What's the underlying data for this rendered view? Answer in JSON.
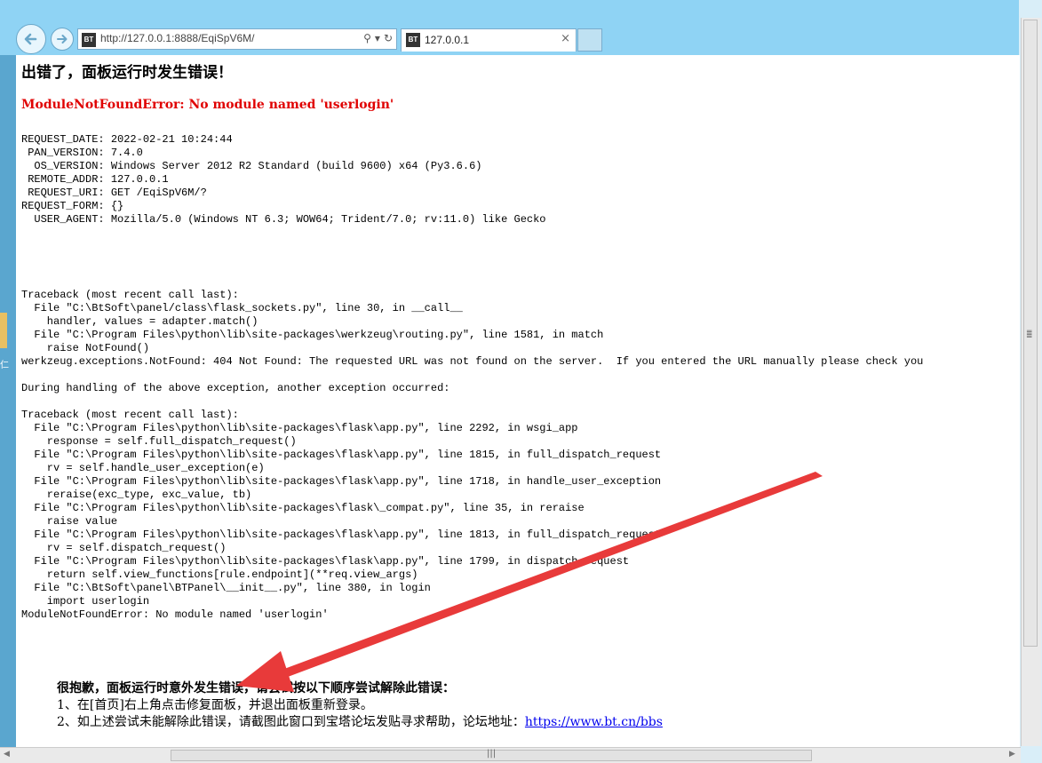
{
  "browser": {
    "url": "http://127.0.0.1:8888/EqiSpV6M/",
    "favicon_text": "BT",
    "tab_title": "127.0.0.1",
    "close_glyph": "×",
    "addr_icons": [
      "⚲",
      "▾",
      "↻"
    ]
  },
  "page": {
    "heading": "出错了，面板运行时发生错误！",
    "error_title": "ModuleNotFoundError: No module named 'userlogin'",
    "request_info": [
      "REQUEST_DATE: 2022-02-21 10:24:44",
      " PAN_VERSION: 7.4.0",
      "  OS_VERSION: Windows Server 2012 R2 Standard (build 9600) x64 (Py3.6.6)",
      " REMOTE_ADDR: 127.0.0.1",
      " REQUEST_URI: GET /EqiSpV6M/?",
      "REQUEST_FORM: {}",
      "  USER_AGENT: Mozilla/5.0 (Windows NT 6.3; WOW64; Trident/7.0; rv:11.0) like Gecko"
    ],
    "traceback": [
      "Traceback (most recent call last):",
      "  File \"C:\\BtSoft\\panel/class\\flask_sockets.py\", line 30, in __call__",
      "    handler, values = adapter.match()",
      "  File \"C:\\Program Files\\python\\lib\\site-packages\\werkzeug\\routing.py\", line 1581, in match",
      "    raise NotFound()",
      "werkzeug.exceptions.NotFound: 404 Not Found: The requested URL was not found on the server.  If you entered the URL manually please check you",
      "",
      "During handling of the above exception, another exception occurred:",
      "",
      "Traceback (most recent call last):",
      "  File \"C:\\Program Files\\python\\lib\\site-packages\\flask\\app.py\", line 2292, in wsgi_app",
      "    response = self.full_dispatch_request()",
      "  File \"C:\\Program Files\\python\\lib\\site-packages\\flask\\app.py\", line 1815, in full_dispatch_request",
      "    rv = self.handle_user_exception(e)",
      "  File \"C:\\Program Files\\python\\lib\\site-packages\\flask\\app.py\", line 1718, in handle_user_exception",
      "    reraise(exc_type, exc_value, tb)",
      "  File \"C:\\Program Files\\python\\lib\\site-packages\\flask\\_compat.py\", line 35, in reraise",
      "    raise value",
      "  File \"C:\\Program Files\\python\\lib\\site-packages\\flask\\app.py\", line 1813, in full_dispatch_request",
      "    rv = self.dispatch_request()",
      "  File \"C:\\Program Files\\python\\lib\\site-packages\\flask\\app.py\", line 1799, in dispatch_request",
      "    return self.view_functions[rule.endpoint](**req.view_args)",
      "  File \"C:\\BtSoft\\panel\\BTPanel\\__init__.py\", line 380, in login",
      "    import userlogin",
      "ModuleNotFoundError: No module named 'userlogin'"
    ],
    "help": {
      "title": "很抱歉，面板运行时意外发生错误，请尝试按以下顺序尝试解除此错误：",
      "step1": "1、在[首页]右上角点击修复面板，并退出面板重新登录。",
      "step2": "2、如上述尝试未能解除此错误，请截图此窗口到宝塔论坛发贴寻求帮助，论坛地址：",
      "forum_link": "https://www.bt.cn/bbs"
    }
  },
  "desktop": {
    "label": "仁"
  },
  "colors": {
    "error_red": "#e00000",
    "link_blue": "#0000ee",
    "arrow_red": "#e83a3a",
    "chrome_blue": "#8fd3f4"
  }
}
